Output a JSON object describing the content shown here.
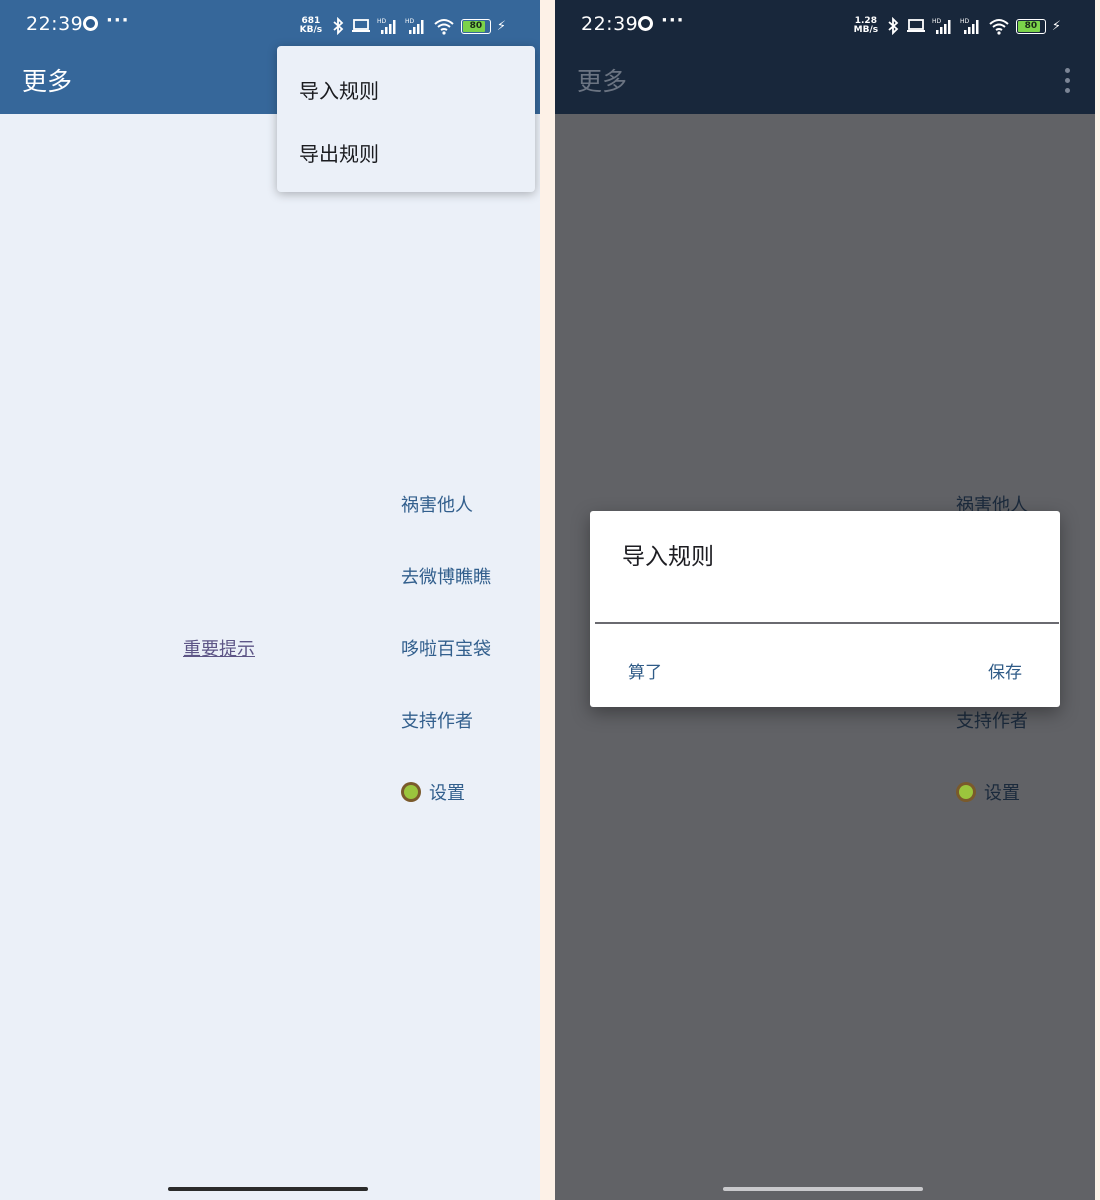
{
  "status_left": {
    "time": "22:39",
    "dots": "···",
    "speed_top": "681",
    "speed_bottom": "KB/s",
    "battery": "80"
  },
  "status_right": {
    "time": "22:39",
    "dots": "···",
    "speed_top": "1.28",
    "speed_bottom": "MB/s",
    "battery": "80"
  },
  "appbar": {
    "title": "更多"
  },
  "overflow_menu": {
    "items": [
      {
        "label": "导入规则"
      },
      {
        "label": "导出规则"
      }
    ]
  },
  "main": {
    "important_link": "重要提示",
    "actions": [
      {
        "label": "祸害他人"
      },
      {
        "label": "去微博瞧瞧"
      },
      {
        "label": "哆啦百宝袋"
      },
      {
        "label": "支持作者"
      },
      {
        "label": "设置",
        "icon": "kiwi-icon"
      }
    ]
  },
  "dialog": {
    "title": "导入规则",
    "input_value": "",
    "cancel_label": "算了",
    "save_label": "保存"
  },
  "colors": {
    "appbar_light": "#36679a",
    "appbar_dark": "#18273b",
    "background": "#ebf0f8",
    "scrim": "#616266",
    "accent_text": "#325f8d",
    "link": "#5d5586"
  }
}
